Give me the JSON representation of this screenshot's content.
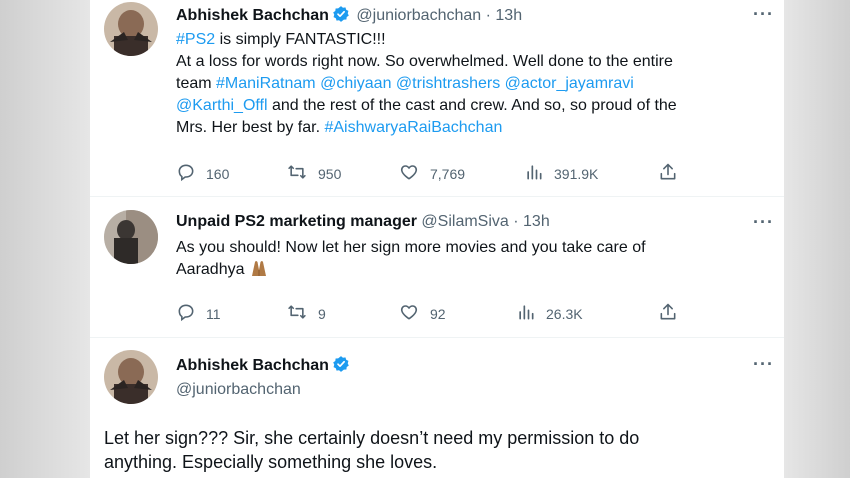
{
  "colors": {
    "link": "#1d9bf0",
    "text": "#0f1419",
    "muted": "#536471",
    "verified": "#1d9bf0"
  },
  "tweet1": {
    "name": "Abhishek Bachchan",
    "handle": "@juniorbachchan",
    "sep": "·",
    "time": "13h",
    "more": "···",
    "lines": {
      "l1_hashtag": "#PS2",
      "l1_rest": " is simply FANTASTIC!!!",
      "l2": "At a loss for words right now. So overwhelmed. Well done to the entire",
      "l3_prefix": "team ",
      "l3_t1": "#ManiRatnam",
      "l3_t2": "@chiyaan",
      "l3_t3": "@trishtrashers",
      "l3_t4": "@actor_jayamravi",
      "l4_t1": "@Karthi_Offl",
      "l4_rest": " and the rest of the cast and crew. And so, so proud of the",
      "l5_prefix": "Mrs. Her best by far. ",
      "l5_tag": "#AishwaryaRaiBachchan"
    },
    "actions": {
      "replies": "160",
      "retweets": "950",
      "likes": "7,769",
      "views": "391.9K"
    }
  },
  "tweet2": {
    "name": "Unpaid PS2 marketing manager",
    "handle": "@SilamSiva",
    "sep": "·",
    "time": "13h",
    "more": "···",
    "line1": "As you should! Now let her sign more movies and you take care of",
    "line2": "Aaradhya",
    "emoji": "folded-hands-emoji",
    "actions": {
      "replies": "11",
      "retweets": "9",
      "likes": "92",
      "views": "26.3K"
    }
  },
  "tweet3": {
    "name": "Abhishek Bachchan",
    "handle": "@juniorbachchan",
    "more": "···",
    "line1": "Let her sign??? Sir, she certainly doesn’t need my permission to do",
    "line2": "anything. Especially something she loves."
  },
  "icons": {
    "reply": "reply-icon",
    "retweet": "retweet-icon",
    "like": "like-icon",
    "views": "views-icon",
    "share": "share-icon",
    "verified": "verified-badge-icon",
    "more": "more-icon"
  }
}
